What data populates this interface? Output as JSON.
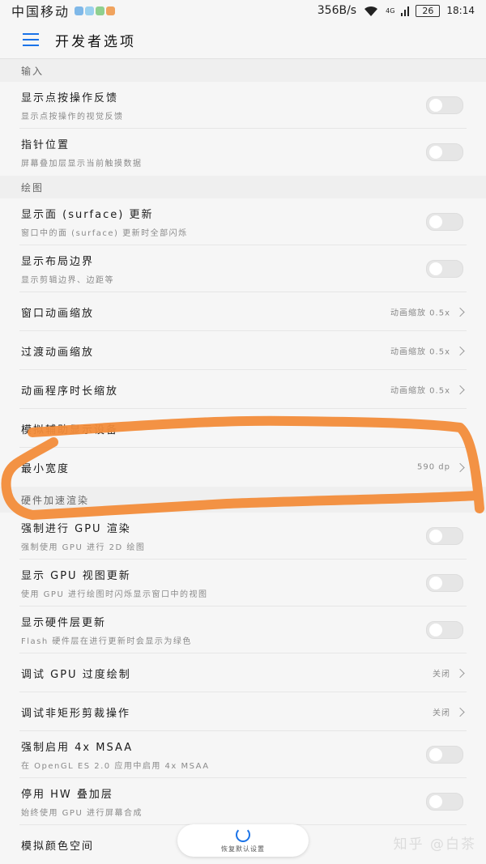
{
  "status_bar": {
    "carrier": "中国移动",
    "network_speed": "356B/s",
    "signal_text": "4G",
    "battery": "26",
    "time": "18:14",
    "notification_icons": [
      "chat-icon",
      "cat-icon",
      "qq-icon",
      "app-icon"
    ]
  },
  "app_bar": {
    "title": "开发者选项"
  },
  "sections": {
    "input": "输入",
    "drawing": "绘图",
    "hw_render": "硬件加速渲染"
  },
  "rows": {
    "show_taps": {
      "label": "显示点按操作反馈",
      "sub": "显示点按操作的视觉反馈",
      "on": false
    },
    "pointer_location": {
      "label": "指针位置",
      "sub": "屏幕叠加层显示当前触摸数据",
      "on": false
    },
    "surface_updates": {
      "label": "显示面 (surface) 更新",
      "sub": "窗口中的面 (surface) 更新时全部闪烁",
      "on": false
    },
    "layout_bounds": {
      "label": "显示布局边界",
      "sub": "显示剪辑边界、边距等",
      "on": false
    },
    "window_anim": {
      "label": "窗口动画缩放",
      "value": "动画缩放 0.5x"
    },
    "transition_anim": {
      "label": "过渡动画缩放",
      "value": "动画缩放 0.5x"
    },
    "animator_duration": {
      "label": "动画程序时长缩放",
      "value": "动画缩放 0.5x"
    },
    "secondary_display": {
      "label": "模拟辅助显示设备"
    },
    "smallest_width": {
      "label": "最小宽度",
      "value": "590 dp"
    },
    "force_gpu": {
      "label": "强制进行 GPU 渲染",
      "sub": "强制使用 GPU 进行 2D 绘图",
      "on": false
    },
    "gpu_view_updates": {
      "label": "显示 GPU 视图更新",
      "sub": "使用 GPU 进行绘图时闪烁显示窗口中的视图",
      "on": false
    },
    "hw_layers": {
      "label": "显示硬件层更新",
      "sub": "Flash 硬件层在进行更新时会显示为绿色",
      "on": false
    },
    "gpu_overdraw": {
      "label": "调试 GPU 过度绘制",
      "value": "关闭"
    },
    "non_rect_clip": {
      "label": "调试非矩形剪裁操作",
      "value": "关闭"
    },
    "msaa": {
      "label": "强制启用 4x MSAA",
      "sub": "在 OpenGL ES 2.0 应用中启用 4x MSAA",
      "on": false
    },
    "disable_overlays": {
      "label": "停用 HW 叠加层",
      "sub": "始终使用 GPU 进行屏幕合成",
      "on": false
    },
    "color_space": {
      "label": "模拟颜色空间"
    }
  },
  "reset_button": {
    "label": "恢复默认设置"
  },
  "watermark": "知乎 @白茶",
  "colors": {
    "accent": "#1a73e8",
    "annotation": "#f28c3a",
    "background": "#f6f6f6"
  }
}
